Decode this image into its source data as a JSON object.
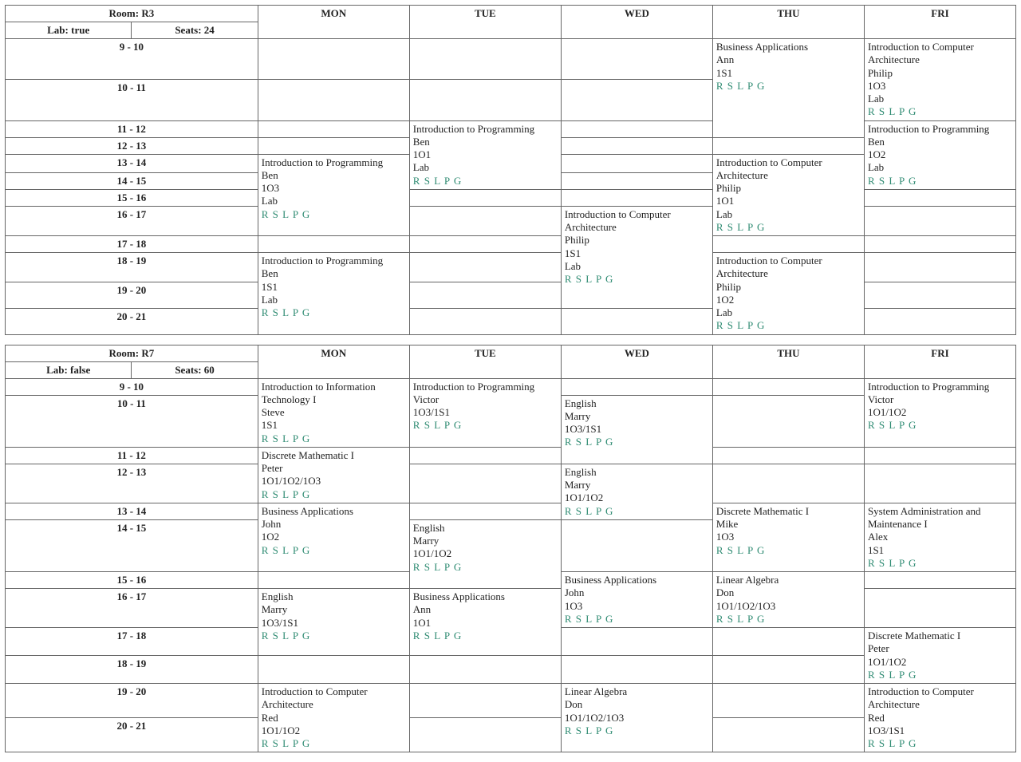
{
  "days": [
    "MON",
    "TUE",
    "WED",
    "THU",
    "FRI"
  ],
  "slots": [
    "9 - 10",
    "10 - 11",
    "11 - 12",
    "12 - 13",
    "13 - 14",
    "14 - 15",
    "15 - 16",
    "16 - 17",
    "17 - 18",
    "18 - 19",
    "19 - 20",
    "20 - 21"
  ],
  "rslpg": "R S L P G",
  "rooms": [
    {
      "name": "R3",
      "lab": "true",
      "seats": "24",
      "courses": [
        {
          "day": 0,
          "start": 4,
          "span": 4,
          "title": "Introduction to Programming",
          "teacher": "Ben",
          "group": "1O3",
          "extra": "Lab"
        },
        {
          "day": 0,
          "start": 9,
          "span": 3,
          "title": "Introduction to Programming",
          "teacher": "Ben",
          "group": "1S1",
          "extra": "Lab"
        },
        {
          "day": 1,
          "start": 2,
          "span": 4,
          "title": "Introduction to Programming",
          "teacher": "Ben",
          "group": "1O1",
          "extra": "Lab"
        },
        {
          "day": 2,
          "start": 7,
          "span": 4,
          "title": "Introduction to Computer Architecture",
          "teacher": "Philip",
          "group": "1S1",
          "extra": "Lab"
        },
        {
          "day": 3,
          "start": 0,
          "span": 3,
          "title": "Business Applications",
          "teacher": "Ann",
          "group": "1S1",
          "extra": ""
        },
        {
          "day": 3,
          "start": 4,
          "span": 4,
          "title": "Introduction to Computer Architecture",
          "teacher": "Philip",
          "group": "1O1",
          "extra": "Lab"
        },
        {
          "day": 3,
          "start": 9,
          "span": 3,
          "title": "Introduction to Computer Architecture",
          "teacher": "Philip",
          "group": "1O2",
          "extra": "Lab"
        },
        {
          "day": 4,
          "start": 0,
          "span": 4,
          "title": "Introduction to Computer Architecture",
          "teacher": "Philip",
          "group": "1O3",
          "extra": "Lab"
        },
        {
          "day": 4,
          "start": 2,
          "overlay": true,
          "span": 4,
          "title": "Introduction to Programming",
          "teacher": "Ben",
          "group": "1O2",
          "extra": "Lab"
        }
      ]
    },
    {
      "name": "R7",
      "lab": "false",
      "seats": "60",
      "courses": [
        {
          "day": 0,
          "start": 0,
          "span": 2,
          "title": "Introduction to Information Technology I",
          "teacher": "Steve",
          "group": "1S1",
          "extra": ""
        },
        {
          "day": 0,
          "start": 2,
          "span": 2,
          "title": "Discrete Mathematic I",
          "teacher": "Peter",
          "group": "1O1/1O2/1O3",
          "extra": ""
        },
        {
          "day": 0,
          "start": 4,
          "span": 2,
          "title": "Business Applications",
          "teacher": "John",
          "group": "1O2",
          "extra": ""
        },
        {
          "day": 0,
          "start": 7,
          "span": 2,
          "title": "English",
          "teacher": "Marry",
          "group": "1O3/1S1",
          "extra": ""
        },
        {
          "day": 0,
          "start": 10,
          "span": 2,
          "title": "Introduction to Computer Architecture",
          "teacher": "Red",
          "group": "1O1/1O2",
          "extra": ""
        },
        {
          "day": 1,
          "start": 0,
          "span": 2,
          "title": "Introduction to Programming",
          "teacher": "Victor",
          "group": "1O3/1S1",
          "extra": ""
        },
        {
          "day": 1,
          "start": 5,
          "span": 2,
          "title": "English",
          "teacher": "Marry",
          "group": "1O1/1O2",
          "extra": ""
        },
        {
          "day": 1,
          "start": 7,
          "span": 2,
          "title": "Business Applications",
          "teacher": "Ann",
          "group": "1O1",
          "extra": ""
        },
        {
          "day": 2,
          "start": 1,
          "span": 2,
          "title": "English",
          "teacher": "Marry",
          "group": "1O3/1S1",
          "extra": ""
        },
        {
          "day": 2,
          "start": 3,
          "span": 2,
          "title": "English",
          "teacher": "Marry",
          "group": "1O1/1O2",
          "extra": ""
        },
        {
          "day": 2,
          "start": 6,
          "span": 2,
          "title": "Business Applications",
          "teacher": "John",
          "group": "1O3",
          "extra": ""
        },
        {
          "day": 2,
          "start": 10,
          "span": 2,
          "title": "Linear Algebra",
          "teacher": "Don",
          "group": "1O1/1O2/1O3",
          "extra": ""
        },
        {
          "day": 3,
          "start": 4,
          "span": 2,
          "title": "Discrete Mathematic I",
          "teacher": "Mike",
          "group": "1O3",
          "extra": ""
        },
        {
          "day": 3,
          "start": 6,
          "span": 2,
          "title": "Linear Algebra",
          "teacher": "Don",
          "group": "1O1/1O2/1O3",
          "extra": ""
        },
        {
          "day": 4,
          "start": 0,
          "span": 2,
          "title": "Introduction to Programming",
          "teacher": "Victor",
          "group": "1O1/1O2",
          "extra": ""
        },
        {
          "day": 4,
          "start": 4,
          "span": 2,
          "title": "System Administration and Maintenance I",
          "teacher": "Alex",
          "group": "1S1",
          "extra": ""
        },
        {
          "day": 4,
          "start": 8,
          "span": 2,
          "title": "Discrete Mathematic I",
          "teacher": "Peter",
          "group": "1O1/1O2",
          "extra": ""
        },
        {
          "day": 4,
          "start": 10,
          "span": 2,
          "title": "Introduction to Computer Architecture",
          "teacher": "Red",
          "group": "1O3/1S1",
          "extra": ""
        }
      ]
    }
  ]
}
